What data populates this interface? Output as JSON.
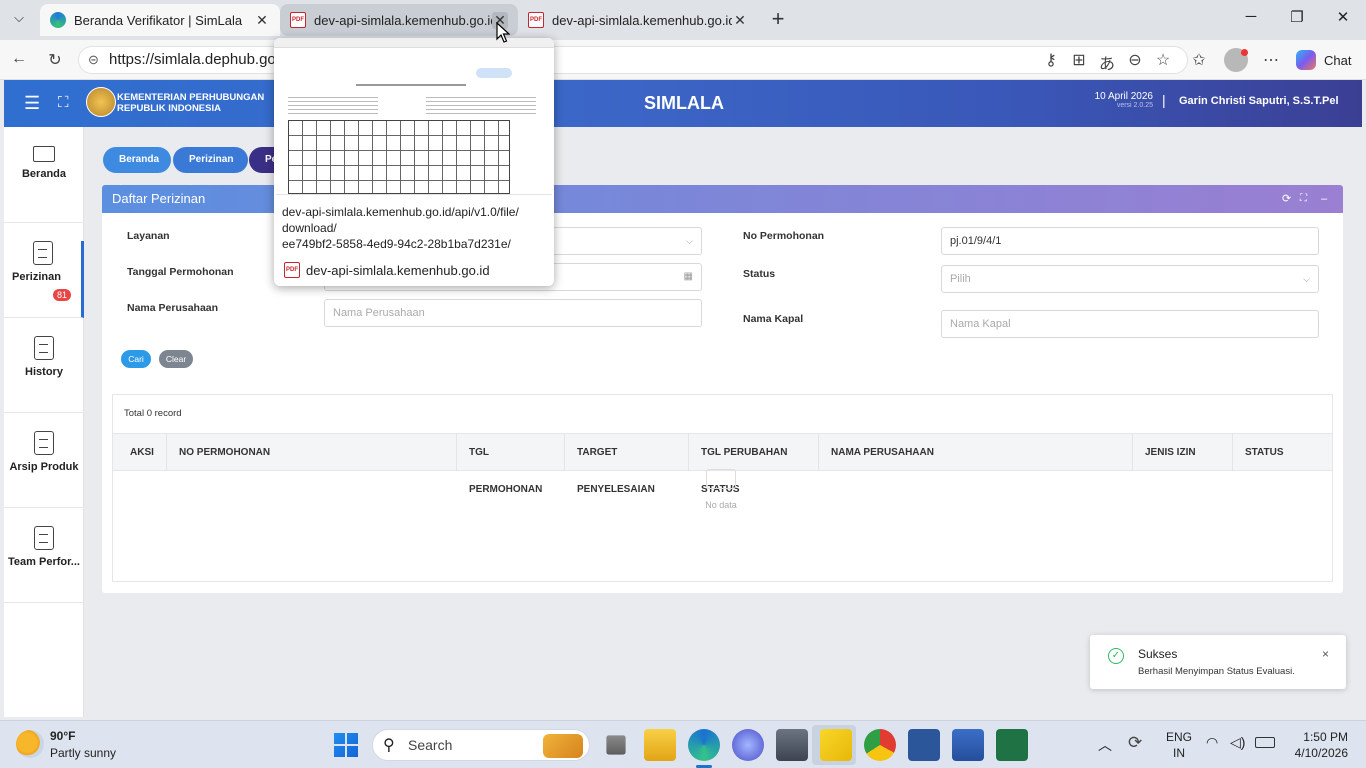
{
  "browser": {
    "tabs": [
      {
        "title": "Beranda Verifikator | SimLala"
      },
      {
        "title": "dev-api-simlala.kemenhub.go.id/a"
      },
      {
        "title": "dev-api-simlala.kemenhub.go.id/a"
      }
    ],
    "url": "https://simlala.dephub.go.id",
    "chat_label": "Chat"
  },
  "tab_preview": {
    "url_text": "dev-api-simlala.kemenhub.go.id/api/v1.0/file/download/ee749bf2-5858-4ed9-94c2-28b1ba7d231e/",
    "url_line1": "dev-api-simlala.kemenhub.go.id/api/v1.0/file/",
    "url_line2": "download/",
    "url_line3": "ee749bf2-5858-4ed9-94c2-28b1ba7d231e/",
    "domain": "dev-api-simlala.kemenhub.go.id"
  },
  "header": {
    "org_line1": "KEMENTERIAN PERHUBUNGAN",
    "org_line2": "REPUBLIK INDONESIA",
    "app_title": "SIMLALA",
    "date": "10 April 2026",
    "version": "versi 2.0.25",
    "user": "Garin Christi Saputri, S.S.T.Pel"
  },
  "sidebar": {
    "items": [
      {
        "label": "Beranda"
      },
      {
        "label": "Perizinan",
        "badge": "81"
      },
      {
        "label": "History"
      },
      {
        "label": "Arsip Produk"
      },
      {
        "label": "Team Perfor..."
      }
    ]
  },
  "breadcrumb": [
    "Beranda",
    "Perizinan",
    "Per"
  ],
  "panel": {
    "title": "Daftar Perizinan",
    "labels": {
      "layanan": "Layanan",
      "tanggal": "Tanggal Permohonan",
      "nama_perusahaan": "Nama Perusahaan",
      "no_permohonan": "No Permohonan",
      "status": "Status",
      "nama_kapal": "Nama Kapal"
    },
    "fields": {
      "nama_perusahaan_placeholder": "Nama Perusahaan",
      "no_permohonan_value": "pj.01/9/4/1",
      "status_placeholder": "Pilih",
      "nama_kapal_placeholder": "Nama Kapal"
    },
    "buttons": {
      "search": "Cari",
      "clear": "Clear"
    },
    "total": "Total 0 record",
    "columns": [
      "AKSI",
      "NO PERMOHONAN",
      "TGL PERMOHONAN",
      "TARGET PENYELESAIAN",
      "TGL PERUBAHAN STATUS",
      "NAMA PERUSAHAAN",
      "JENIS IZIN",
      "STATUS"
    ],
    "empty_text": "No data"
  },
  "toast": {
    "title": "Sukses",
    "message": "Berhasil Menyimpan Status Evaluasi."
  },
  "taskbar": {
    "weather_temp": "90°F",
    "weather_desc": "Partly sunny",
    "search_label": "Search",
    "lang1": "ENG",
    "lang2": "IN",
    "time": "1:50 PM",
    "date": "4/10/2026"
  },
  "colors": {
    "accent": "#2f6fd0",
    "toast_success": "#2eb85c",
    "badge": "#e84545"
  }
}
